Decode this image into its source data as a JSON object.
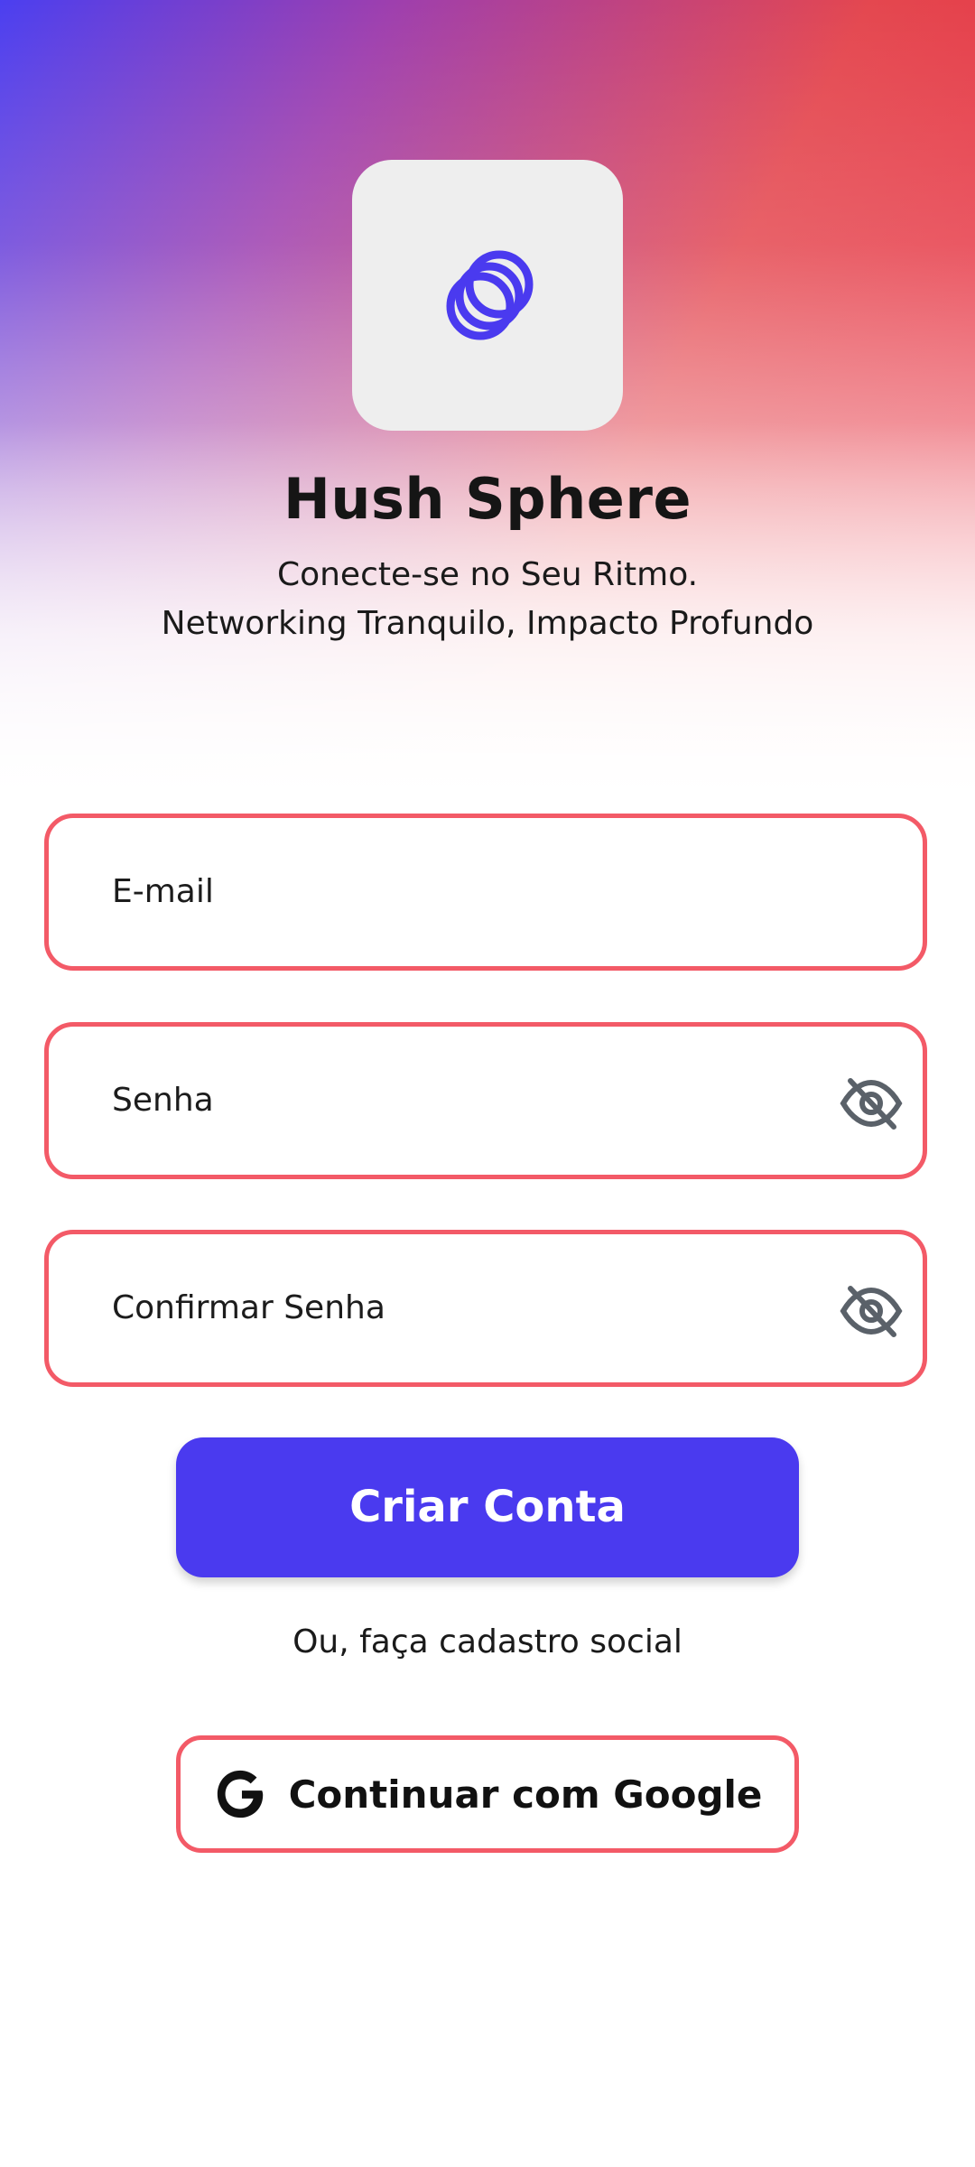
{
  "app": {
    "name": "Hush Sphere",
    "tagline_line1": "Conecte-se no Seu Ritmo.",
    "tagline_line2": "Networking Tranquilo, Impacto Profundo",
    "logo_icon": "interlocking-rings-icon"
  },
  "form": {
    "email_placeholder": "E-mail",
    "password_placeholder": "Senha",
    "confirm_password_placeholder": "Confirmar Senha",
    "visibility_icon": "eye-off-icon",
    "submit_label": "Criar Conta"
  },
  "social": {
    "caption": "Ou, faça cadastro social",
    "google_label": "Continuar com Google",
    "google_icon": "google-icon"
  },
  "colors": {
    "accent": "#4a3aef",
    "field_border": "#f35a67",
    "gradient_start": "#4b3ff0",
    "gradient_end": "#ea2a3e"
  }
}
